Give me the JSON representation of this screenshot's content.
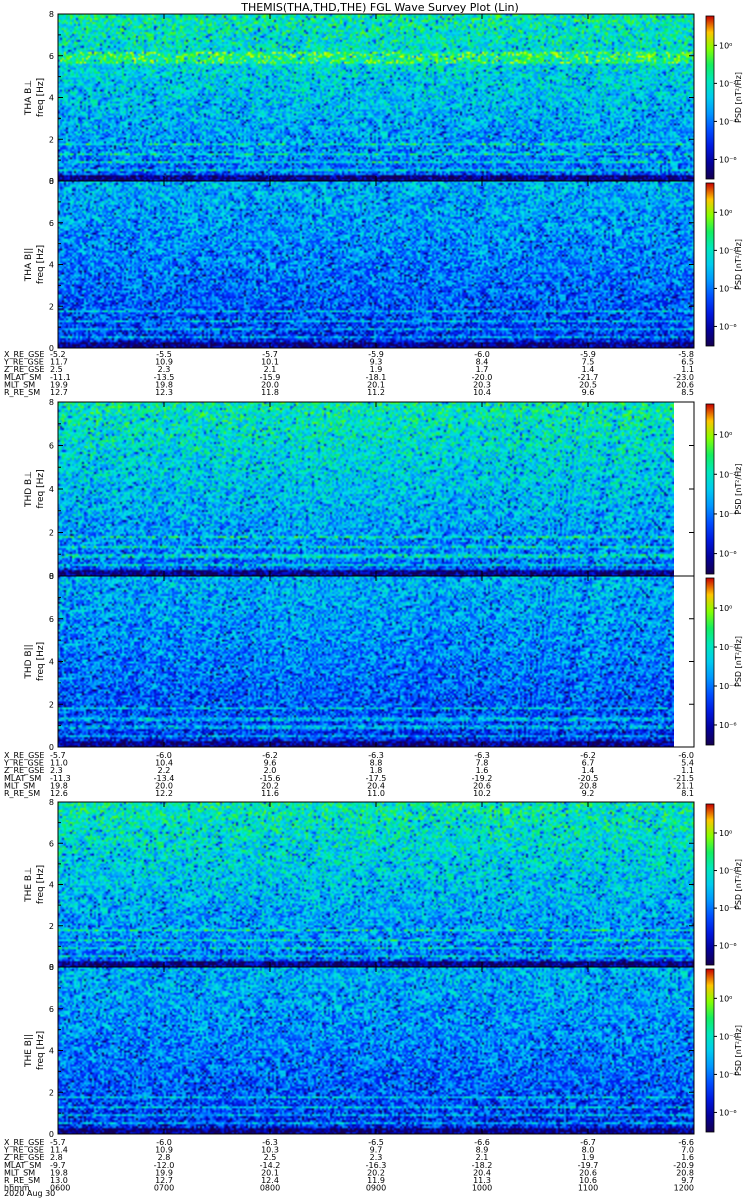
{
  "chart_data": {
    "type": "heatmap",
    "title": "THEMIS(THA,THD,THE) FGL Wave Survey Plot (Lin)",
    "x_tick_labels": [
      "0600",
      "0700",
      "0800",
      "0900",
      "1000",
      "1100",
      "1200"
    ],
    "x_tick_label_name": "hhmm",
    "date": "2020 Aug 30",
    "y_ticks": [
      "0",
      "2",
      "4",
      "6",
      "8"
    ],
    "y_range": [
      0,
      8
    ],
    "colorbar_label": "PSD [nT²/Hz]",
    "colorscale": "rainbow (dark blue → cyan → green → yellow → red)",
    "panels": [
      {
        "probe": "THA",
        "component": "B⊥",
        "ylabel_top": "THA B⊥",
        "ylabel_bottom": "freq [Hz]",
        "cbar_ticks": [
          "10⁰",
          "10⁻²",
          "10⁻⁴",
          "10⁻⁶"
        ],
        "colorbar_range": "log",
        "has_gap_right": false
      },
      {
        "probe": "THA",
        "component": "B||",
        "ylabel_top": "THA B||",
        "ylabel_bottom": "freq [Hz]",
        "cbar_ticks": [
          "10⁰",
          "10⁻²",
          "10⁻⁴",
          "10⁻⁶"
        ],
        "colorbar_range": "log",
        "has_gap_right": false
      },
      {
        "probe": "THD",
        "component": "B⊥",
        "ylabel_top": "THD B⊥",
        "ylabel_bottom": "freq [Hz]",
        "cbar_ticks": [
          "10⁰",
          "10⁻²",
          "10⁻⁴",
          "10⁻⁶"
        ],
        "colorbar_range": "log",
        "has_gap_right": true
      },
      {
        "probe": "THD",
        "component": "B||",
        "ylabel_top": "THD B||",
        "ylabel_bottom": "freq [Hz]",
        "cbar_ticks": [
          "10⁰",
          "10⁻²",
          "10⁻⁴",
          "10⁻⁶"
        ],
        "colorbar_range": "log",
        "has_gap_right": true
      },
      {
        "probe": "THE",
        "component": "B⊥",
        "ylabel_top": "THE B⊥",
        "ylabel_bottom": "freq [Hz]",
        "cbar_ticks": [
          "10⁰",
          "10⁻²",
          "10⁻⁴",
          "10⁻⁶"
        ],
        "colorbar_range": "log",
        "has_gap_right": false
      },
      {
        "probe": "THE",
        "component": "B||",
        "ylabel_top": "THE B||",
        "ylabel_bottom": "freq [Hz]",
        "cbar_ticks": [
          "10⁰",
          "10⁻²",
          "10⁻⁴",
          "10⁻⁶"
        ],
        "colorbar_range": "log",
        "has_gap_right": false
      }
    ],
    "ephemeris": [
      {
        "rows": [
          {
            "label": "X_RE_GSE",
            "values": [
              "-5.2",
              "-5.5",
              "-5.7",
              "-5.9",
              "-6.0",
              "-5.9",
              "-5.8"
            ]
          },
          {
            "label": "Y_RE_GSE",
            "values": [
              "11.7",
              "10.9",
              "10.1",
              "9.3",
              "8.4",
              "7.5",
              "6.5"
            ]
          },
          {
            "label": "Z_RE_GSE",
            "values": [
              "2.5",
              "2.3",
              "2.1",
              "1.9",
              "1.7",
              "1.4",
              "1.1"
            ]
          },
          {
            "label": "MLAT_SM",
            "values": [
              "-11.1",
              "-13.5",
              "-15.9",
              "-18.1",
              "-20.0",
              "-21.7",
              "-23.0"
            ]
          },
          {
            "label": "MLT_SM",
            "values": [
              "19.9",
              "19.8",
              "20.0",
              "20.1",
              "20.3",
              "20.5",
              "20.6"
            ]
          },
          {
            "label": "R_RE_SM",
            "values": [
              "12.7",
              "12.3",
              "11.8",
              "11.2",
              "10.4",
              "9.6",
              "8.5"
            ]
          }
        ]
      },
      {
        "rows": [
          {
            "label": "X_RE_GSE",
            "values": [
              "-5.7",
              "-6.0",
              "-6.2",
              "-6.3",
              "-6.3",
              "-6.2",
              "-6.0"
            ]
          },
          {
            "label": "Y_RE_GSE",
            "values": [
              "11.0",
              "10.4",
              "9.6",
              "8.8",
              "7.8",
              "6.7",
              "5.4"
            ]
          },
          {
            "label": "Z_RE_GSE",
            "values": [
              "2.3",
              "2.2",
              "2.0",
              "1.8",
              "1.6",
              "1.4",
              "1.1"
            ]
          },
          {
            "label": "MLAT_SM",
            "values": [
              "-11.3",
              "-13.4",
              "-15.6",
              "-17.5",
              "-19.2",
              "-20.5",
              "-21.5"
            ]
          },
          {
            "label": "MLT_SM",
            "values": [
              "19.8",
              "20.0",
              "20.2",
              "20.4",
              "20.6",
              "20.8",
              "21.1"
            ]
          },
          {
            "label": "R_RE_SM",
            "values": [
              "12.6",
              "12.2",
              "11.6",
              "11.0",
              "10.2",
              "9.2",
              "8.1"
            ]
          }
        ]
      },
      {
        "rows": [
          {
            "label": "X_RE_GSE",
            "values": [
              "-5.7",
              "-6.0",
              "-6.3",
              "-6.5",
              "-6.6",
              "-6.7",
              "-6.6"
            ]
          },
          {
            "label": "Y_RE_GSE",
            "values": [
              "11.4",
              "10.9",
              "10.3",
              "9.7",
              "8.9",
              "8.0",
              "7.0"
            ]
          },
          {
            "label": "Z_RE_GSE",
            "values": [
              "2.8",
              "2.8",
              "2.5",
              "2.3",
              "2.1",
              "1.9",
              "1.6"
            ]
          },
          {
            "label": "MLAT_SM",
            "values": [
              "-9.7",
              "-12.0",
              "-14.2",
              "-16.3",
              "-18.2",
              "-19.7",
              "-20.9"
            ]
          },
          {
            "label": "MLT_SM",
            "values": [
              "19.8",
              "19.9",
              "20.1",
              "20.2",
              "20.4",
              "20.6",
              "20.8"
            ]
          },
          {
            "label": "R_RE_SM",
            "values": [
              "13.0",
              "12.7",
              "12.4",
              "11.9",
              "11.3",
              "10.6",
              "9.7"
            ]
          },
          {
            "label": "hhmm",
            "values": [
              "0600",
              "0700",
              "0800",
              "0900",
              "1000",
              "1100",
              "1200"
            ]
          }
        ]
      }
    ]
  }
}
